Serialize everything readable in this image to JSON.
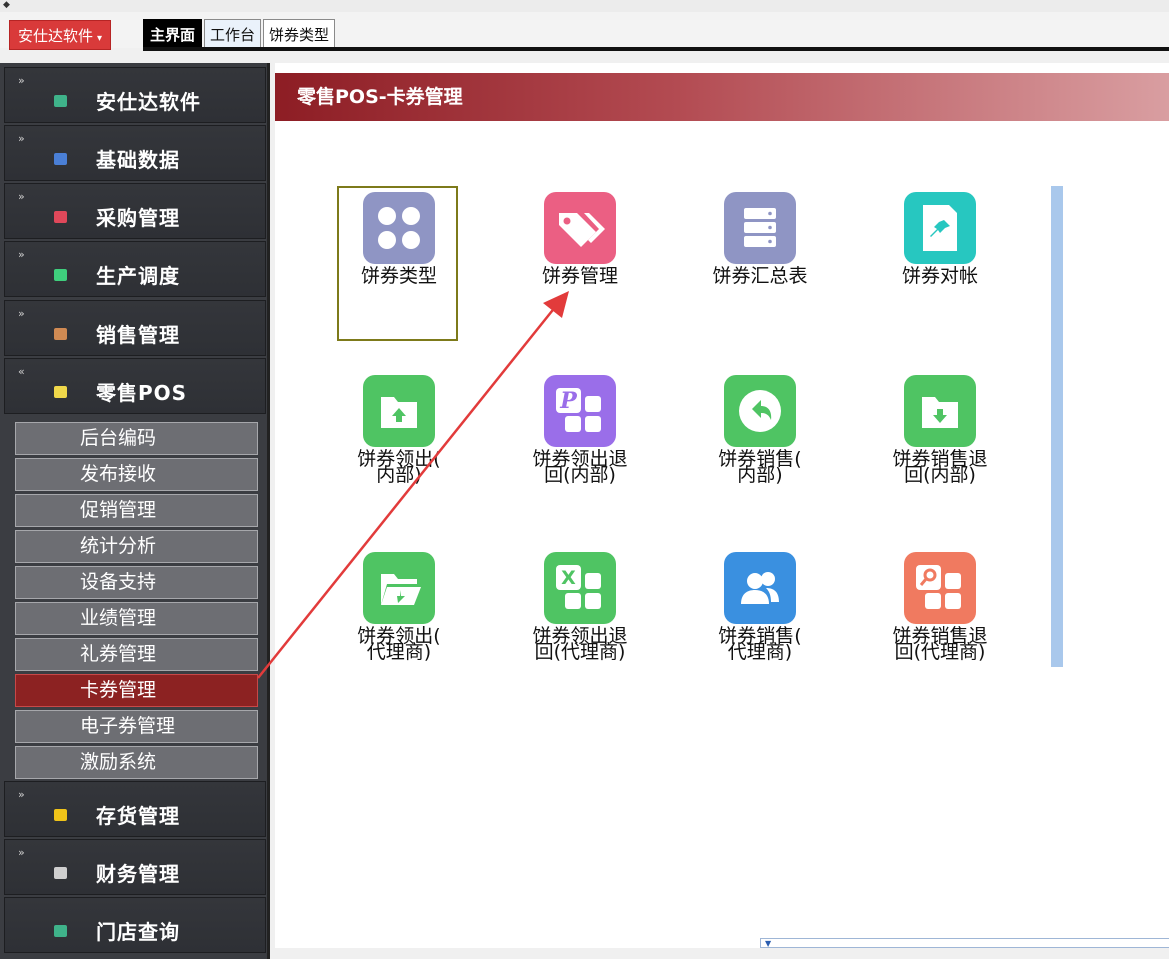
{
  "app_menu": {
    "label": "安仕达软件",
    "caret": "▾"
  },
  "tabs": [
    "主界面",
    "工作台",
    "饼券类型"
  ],
  "sidebar": {
    "sections": [
      {
        "label": "安仕达软件",
        "chevron": "»",
        "icon_color": "#3fb38a"
      },
      {
        "label": "基础数据",
        "chevron": "»",
        "icon_color": "#4a7fd6"
      },
      {
        "label": "采购管理",
        "chevron": "»",
        "icon_color": "#e0485a"
      },
      {
        "label": "生产调度",
        "chevron": "»",
        "icon_color": "#3fcf7d"
      },
      {
        "label": "销售管理",
        "chevron": "»",
        "icon_color": "#d08a53"
      },
      {
        "label": "零售POS",
        "chevron": "«",
        "icon_color": "#f0d84a"
      },
      {
        "label": "存货管理",
        "chevron": "»",
        "icon_color": "#f0c419"
      },
      {
        "label": "财务管理",
        "chevron": "»",
        "icon_color": "#cfcfcf"
      },
      {
        "label": "门店查询",
        "chevron": "",
        "icon_color": "#3fb38a"
      }
    ],
    "pos_items": [
      "后台编码",
      "发布接收",
      "促销管理",
      "统计分析",
      "设备支持",
      "业绩管理",
      "礼券管理",
      "卡券管理",
      "电子券管理",
      "激励系统"
    ],
    "selected_item": "卡券管理"
  },
  "page": {
    "title": "零售POS-卡券管理",
    "items": [
      {
        "lines": [
          "饼券类型"
        ],
        "color": "#8f95c4",
        "icon": "grid-icon"
      },
      {
        "lines": [
          "饼券管理"
        ],
        "color": "#eb5f83",
        "icon": "tags-icon"
      },
      {
        "lines": [
          "饼券汇总表"
        ],
        "color": "#8f95c4",
        "icon": "server-icon"
      },
      {
        "lines": [
          "饼券对帐"
        ],
        "color": "#27c7c0",
        "icon": "pin-icon"
      },
      {
        "lines": [
          "饼券领出(",
          "内部)"
        ],
        "color": "#4fc463",
        "icon": "folder-up-icon"
      },
      {
        "lines": [
          "饼券领出退",
          "回(内部)"
        ],
        "color": "#9a6ee9",
        "icon": "p-grid-icon"
      },
      {
        "lines": [
          "饼券销售(",
          "内部)"
        ],
        "color": "#4fc463",
        "icon": "undo-circle-icon"
      },
      {
        "lines": [
          "饼券销售退",
          "回(内部)"
        ],
        "color": "#4fc463",
        "icon": "folder-down-icon"
      },
      {
        "lines": [
          "饼券领出(",
          "代理商)"
        ],
        "color": "#4fc463",
        "icon": "folder-open-icon"
      },
      {
        "lines": [
          "饼券领出退",
          "回(代理商)"
        ],
        "color": "#4fc463",
        "icon": "excel-grid-icon"
      },
      {
        "lines": [
          "饼券销售(",
          "代理商)"
        ],
        "color": "#3a90e0",
        "icon": "users-icon"
      },
      {
        "lines": [
          "饼券销售退",
          "回(代理商)"
        ],
        "color": "#f07a60",
        "icon": "search-grid-icon"
      }
    ]
  },
  "annotation_color": "#e23b3b"
}
